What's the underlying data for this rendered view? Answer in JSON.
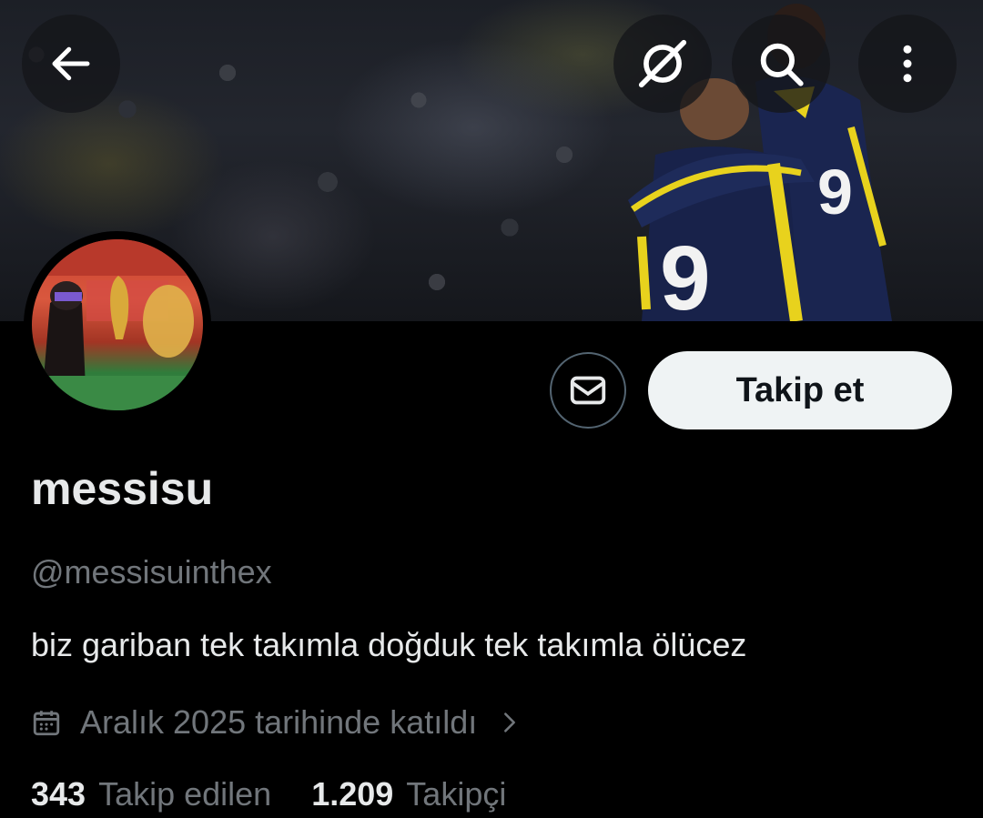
{
  "topbar": {
    "back_icon": "arrow-left-icon",
    "grok_icon": "grok-icon",
    "search_icon": "search-icon",
    "more_icon": "more-vertical-icon"
  },
  "profile": {
    "display_name": "messisu",
    "handle": "@messisuinthex",
    "bio": "biz gariban tek takımla doğduk tek takımla ölücez",
    "joined": "Aralık 2025 tarihinde katıldı",
    "following_count": "343",
    "following_label": "Takip edilen",
    "followers_count": "1.209",
    "followers_label": "Takipçi"
  },
  "actions": {
    "follow_label": "Takip et",
    "message_icon": "envelope-icon"
  },
  "colors": {
    "background": "#000000",
    "primary_text": "#e7e9ea",
    "secondary_text": "#71767b",
    "button_bg": "#eff3f4",
    "button_text": "#0f1419",
    "border": "#536471"
  }
}
